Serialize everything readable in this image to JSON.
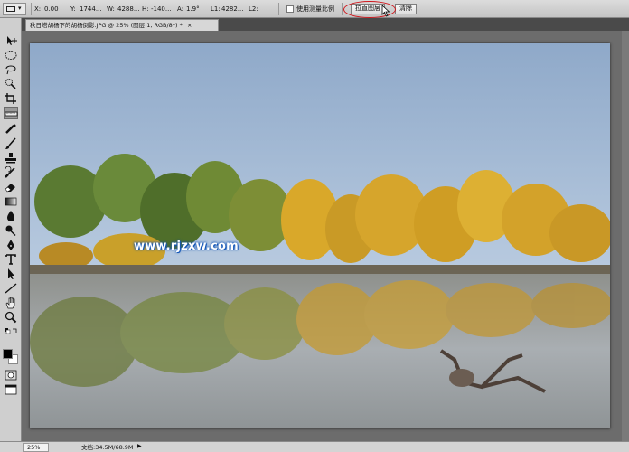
{
  "options_bar": {
    "x_label": "X:",
    "x_value": "0.00",
    "y_label": "Y:",
    "y_value": "1744...",
    "w_label": "W:",
    "w_value": "4288...",
    "h_label": "H:",
    "h_value": "-140...",
    "angle_label": "A:",
    "angle_value": "1.9°",
    "l1_label": "L1:",
    "l1_value": "4282...",
    "l2_label": "L2:",
    "use_measurement_scale": "使用测量比例",
    "straighten_button": "拉直图层",
    "clear_button": "清除"
  },
  "document": {
    "tab_title": "秋日塔胡杨下的胡杨倒影.JPG @ 25% (图层 1, RGB/8*) *",
    "close_glyph": "×"
  },
  "watermark": "www.rjzxw.com",
  "status_bar": {
    "zoom": "25%",
    "doc_info": "文档:34.5M/68.9M",
    "arrow": "▶"
  },
  "tools": [
    {
      "name": "move-tool-icon"
    },
    {
      "name": "marquee-tool-icon"
    },
    {
      "name": "lasso-tool-icon"
    },
    {
      "name": "quick-selection-tool-icon"
    },
    {
      "name": "crop-tool-icon"
    },
    {
      "name": "ruler-tool-icon"
    },
    {
      "name": "spot-healing-tool-icon"
    },
    {
      "name": "brush-tool-icon"
    },
    {
      "name": "clone-stamp-tool-icon"
    },
    {
      "name": "history-brush-tool-icon"
    },
    {
      "name": "eraser-tool-icon"
    },
    {
      "name": "gradient-tool-icon"
    },
    {
      "name": "blur-tool-icon"
    },
    {
      "name": "dodge-tool-icon"
    },
    {
      "name": "pen-tool-icon"
    },
    {
      "name": "type-tool-icon"
    },
    {
      "name": "path-selection-tool-icon"
    },
    {
      "name": "line-shape-tool-icon"
    },
    {
      "name": "hand-tool-icon"
    },
    {
      "name": "zoom-tool-icon"
    }
  ],
  "colors": {
    "callout": "#d0181e",
    "watermark_glow": "#1456b8",
    "foreground": "#000000",
    "background": "#ffffff"
  }
}
